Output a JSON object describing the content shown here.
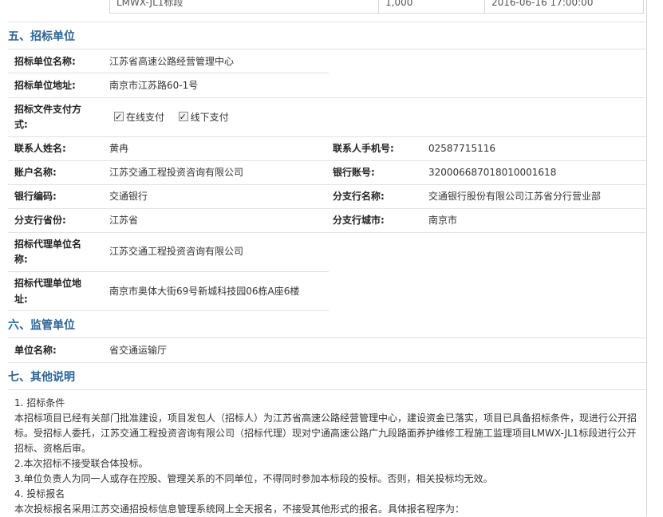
{
  "top_row": {
    "section": "LMWX-JL1标段",
    "amount": "1,000",
    "time": "2016-06-16 17:00:00"
  },
  "s5": {
    "title": "五、招标单位",
    "unit_name_label": "招标单位名称:",
    "unit_name": "江苏省高速公路经营管理中心",
    "address_label": "招标单位地址:",
    "address": "南京市江苏路60-1号",
    "pay_label_1": "招标文件支付方",
    "pay_label_2": "式:",
    "pay_online": "在线支付",
    "pay_offline": "线下支付",
    "contact_label": "联系人姓名:",
    "contact": "黄冉",
    "phone_label": "联系人手机号:",
    "phone": "02587715116",
    "account_name_label": "账户名称:",
    "account_name": "江苏交通工程投资咨询有限公司",
    "account_no_label": "银行账号:",
    "account_no": "32000668701801000161​8",
    "bank_code_label": "银行编码:",
    "bank_code": "交通银行",
    "branch_name_label": "分支行名称:",
    "branch_name": "交通银行股份有限公司江苏省分行营业部",
    "branch_prov_label": "分支行省份:",
    "branch_prov": "江苏省",
    "branch_city_label": "分支行城市:",
    "branch_city": "南京市",
    "agent_name_label_1": "招标代理单位名",
    "agent_name_label_2": "称:",
    "agent_name": "江苏交通工程投资咨询有限公司",
    "agent_addr_label_1": "招标代理单位地",
    "agent_addr_label_2": "址:",
    "agent_addr": "南京市奥体大街69号新城科技园06栋A座6楼"
  },
  "s6": {
    "title": "六、监管单位",
    "unit_label": "单位名称:",
    "unit": "省交通运输厅"
  },
  "s7": {
    "title": "七、其他说明",
    "lines": [
      "1. 招标条件",
      "本招标项目已经有关部门批准建设，项目发包人（招标人）为江苏省高速公路经营管理中心，建设资金已落实，项目已具备招标条件，现进行公开招标。受招标人委托，江苏交通工程投资咨询有限公司（招标代理）现对宁通高速公路广九段路面养护维修工程施工监理项目LMWX-JL1标段进行公开招标、资格后审。",
      "2.本次招标不接受联合体投标。",
      "3.单位负责人为同一人或存在控股、管理关系的不同单位，不得同时参加本标段的投标。否则，相关投标均无效。",
      "4. 投标报名",
      "本次投标报名采用江苏交通招投标信息管理系统网上全天报名，不接受其他形式的报名。具体报名程序为："
    ]
  }
}
